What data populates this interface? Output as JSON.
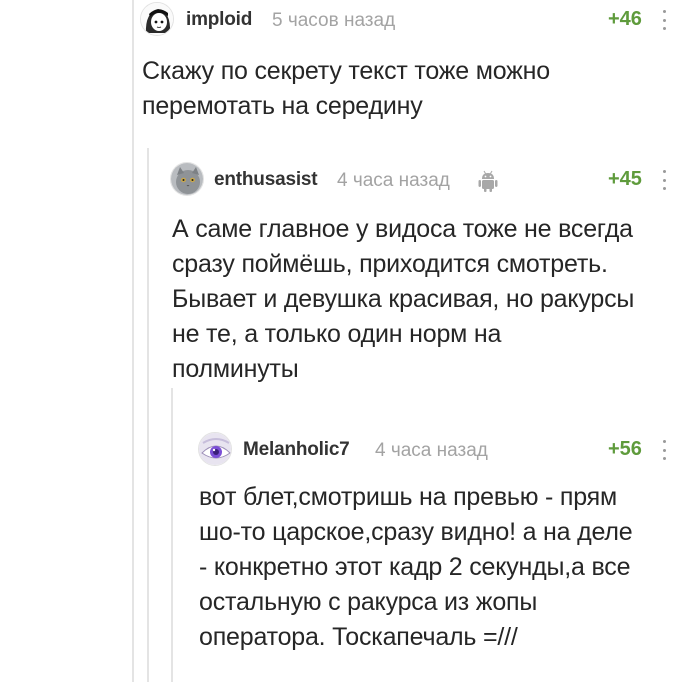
{
  "comments": [
    {
      "author": "imploid",
      "time": "5 часов назад",
      "rating": "+46",
      "avatar": "anime-girl-avatar",
      "text": "Скажу по секрету текст тоже можно\nперемотать на середину"
    },
    {
      "author": "enthusasist",
      "time": "4 часа назад",
      "rating": "+45",
      "avatar": "cat-avatar",
      "device": "android-icon",
      "text": "А саме главное у видоса тоже не всегда\nсразу поймёшь, приходится смотреть.\nБывает и девушка красивая, но ракурсы\nне те, а только один норм на\nполминуты"
    },
    {
      "author": "Melanholic7",
      "time": "4 часа назад",
      "rating": "+56",
      "avatar": "purple-eye-avatar",
      "text": "вот блет,смотришь на превью - прям\nшо-то царское,сразу видно! а на деле\n- конкретно этот кадр 2 секунды,а все\nостальную с ракурса из жопы\nоператора. Тоскапечаль =///"
    }
  ],
  "colors": {
    "rating": "#5f9b3c",
    "time": "#a3a3a3",
    "thread_line": "#e4e4e4",
    "text": "#262626"
  }
}
